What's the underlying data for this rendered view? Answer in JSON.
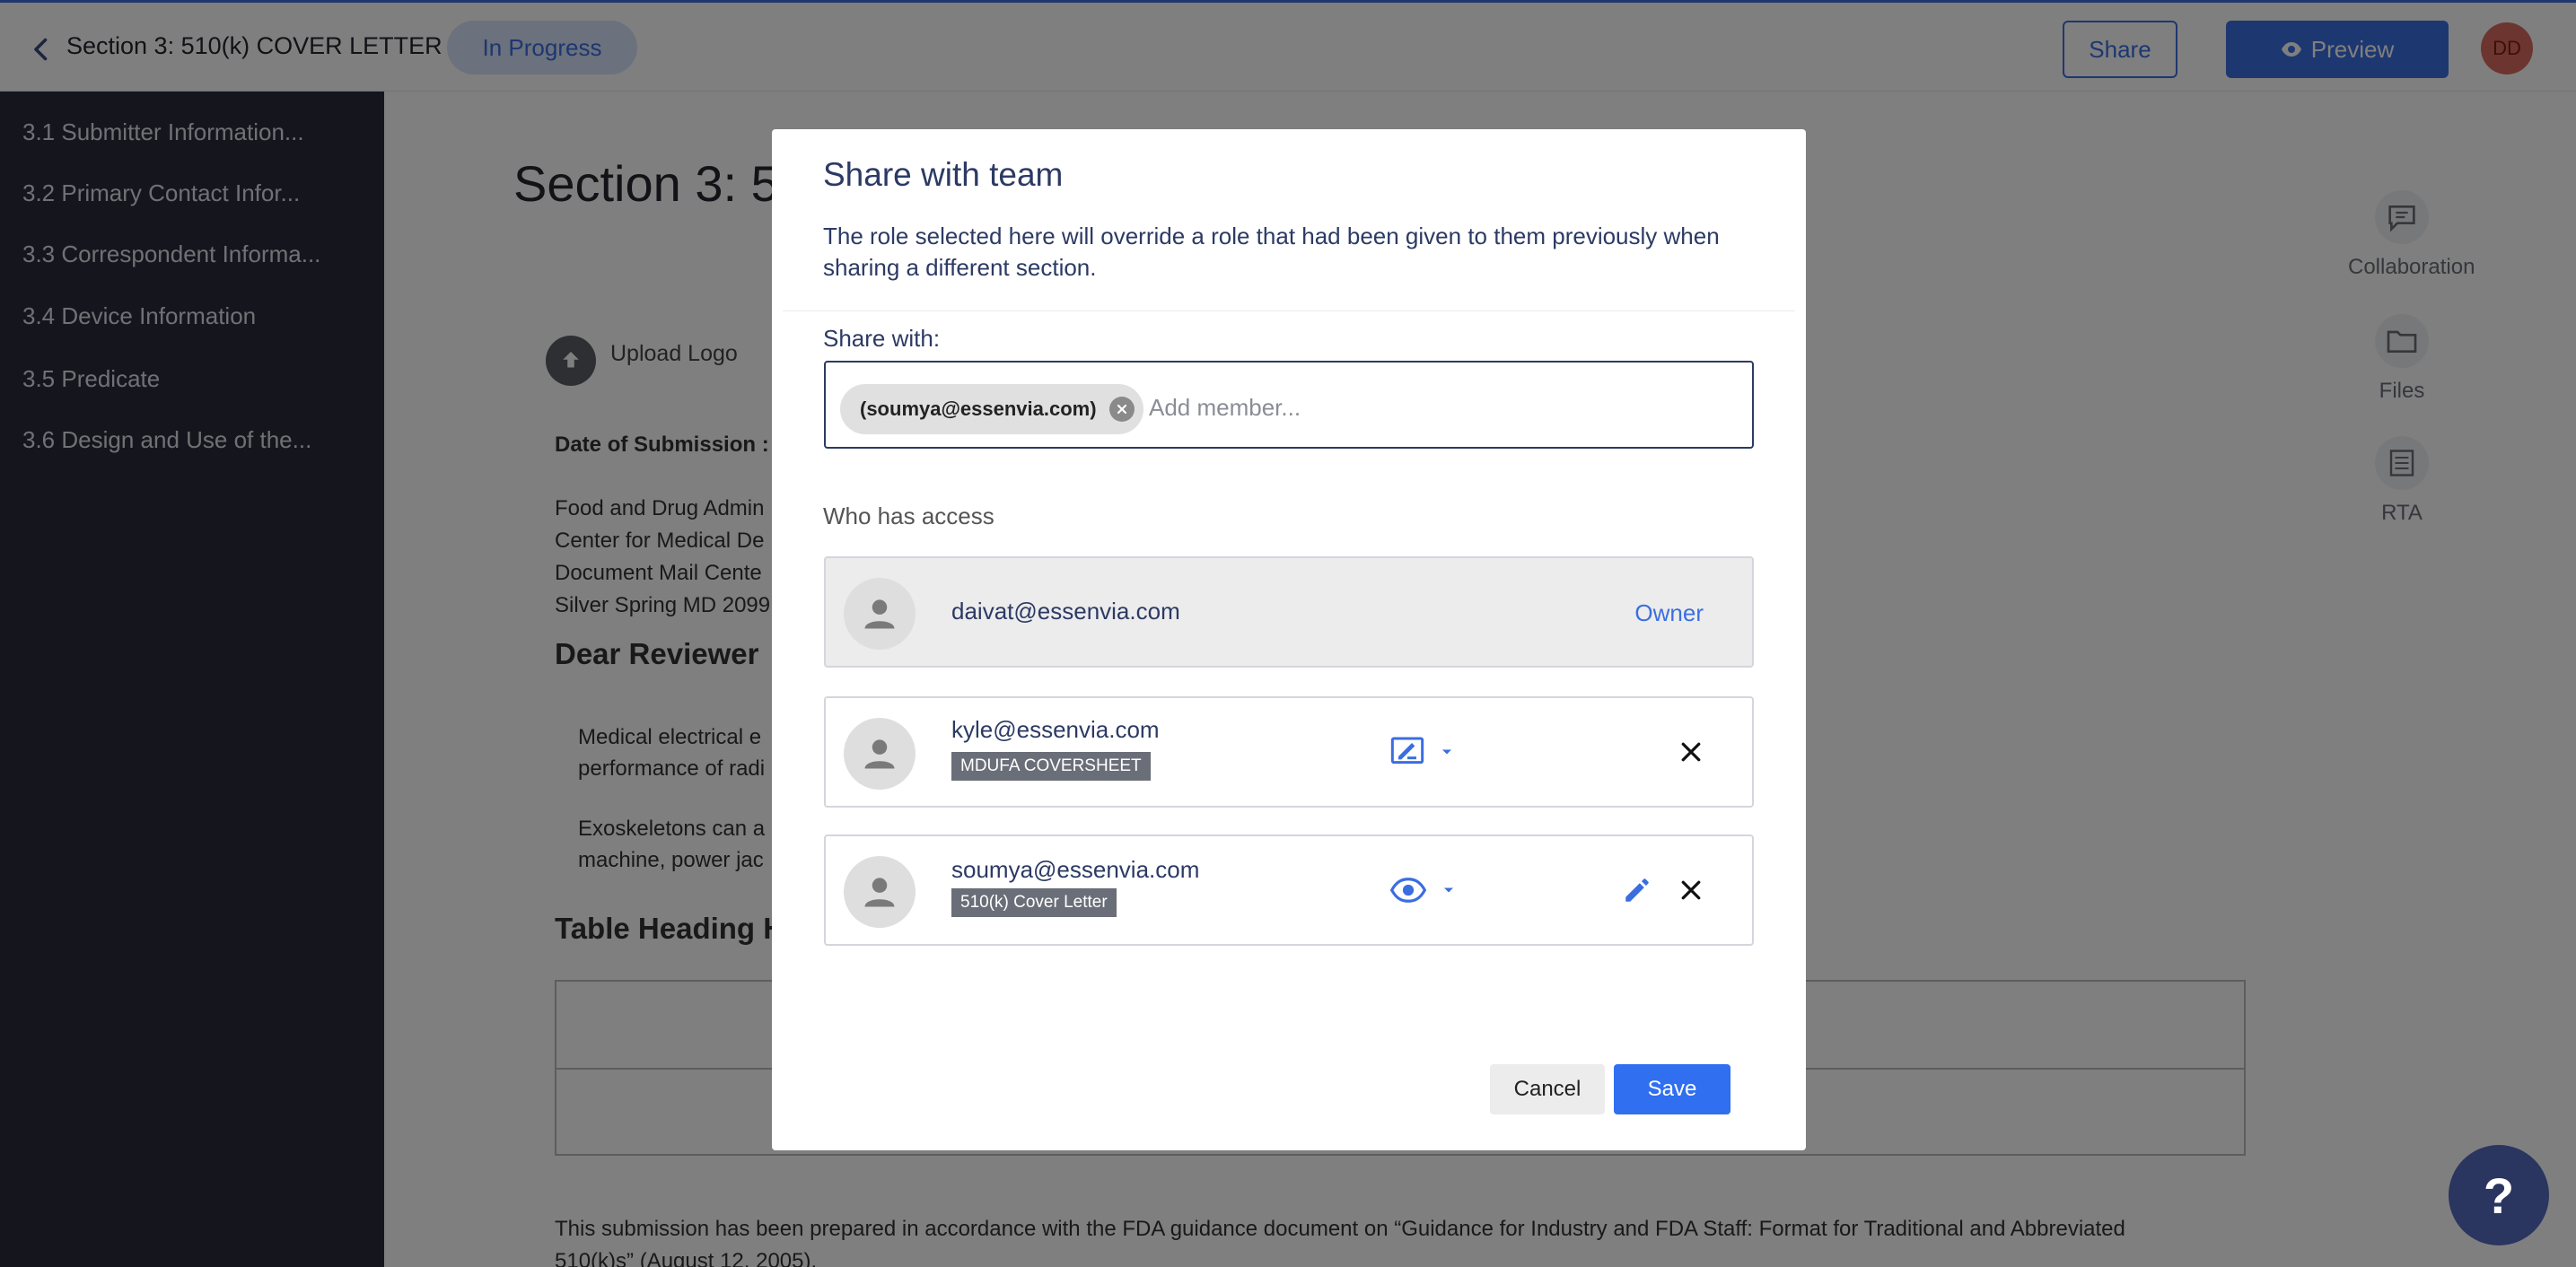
{
  "header": {
    "title": "Section 3:  510(k) COVER LETTER",
    "status": "In Progress",
    "share_label": "Share",
    "preview_label": "Preview",
    "avatar_initials": "DD"
  },
  "sidebar": {
    "items": [
      {
        "label": "3.1 Submitter Information..."
      },
      {
        "label": "3.2 Primary Contact Infor..."
      },
      {
        "label": "3.3 Correspondent Informa..."
      },
      {
        "label": "3.4 Device Information"
      },
      {
        "label": "3.5 Predicate"
      },
      {
        "label": "3.6 Design and Use of the..."
      }
    ]
  },
  "document": {
    "title": "Section 3: 5",
    "upload_logo": "Upload Logo",
    "date_label": "Date of Submission :",
    "address_lines": [
      "Food and Drug Admin",
      "Center for Medical De",
      "Document Mail Cente",
      "Silver Spring MD 2099"
    ],
    "salutation": "Dear Reviewer",
    "para1_lines": [
      "Medical electrical e",
      "performance of radi"
    ],
    "para2_lines": [
      "Exoskeletons can a",
      "machine, power jac"
    ],
    "table_heading": "Table Heading H",
    "footer_lines": [
      "This submission has been prepared in accordance with the FDA guidance document on “Guidance for Industry and FDA Staff: Format for Traditional and Abbreviated",
      "510(k)s” (August 12, 2005)."
    ]
  },
  "right_tools": {
    "collaboration": "Collaboration",
    "files": "Files",
    "rta": "RTA"
  },
  "help": {
    "label": "?"
  },
  "modal": {
    "title": "Share with team",
    "description": "The role selected here will override a role that had been given to them previously when sharing a different section.",
    "share_with_label": "Share with:",
    "chip_email": "(soumya@essenvia.com)",
    "add_member_placeholder": "Add member...",
    "who_has_access_label": "Who has access",
    "access": [
      {
        "email": "daivat@essenvia.com",
        "role": "Owner"
      },
      {
        "email": "kyle@essenvia.com",
        "section": "MDUFA COVERSHEET",
        "permission_icon": "edit-note-icon"
      },
      {
        "email": "soumya@essenvia.com",
        "section": "510(k) Cover Letter",
        "permission_icon": "eye-icon"
      }
    ],
    "cancel_label": "Cancel",
    "save_label": "Save"
  },
  "colors": {
    "accent": "#3a6ee0",
    "sidebar_bg": "#2b2d3b",
    "modal_text": "#2c3a64",
    "save_bg": "#2f6ff0",
    "help_bg": "#2a3560"
  }
}
